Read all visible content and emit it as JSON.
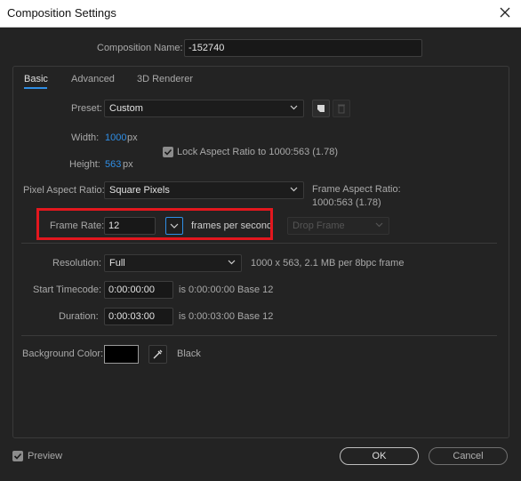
{
  "window": {
    "title": "Composition Settings"
  },
  "composition_name": {
    "label": "Composition Name:",
    "value": "-152740"
  },
  "tabs": [
    {
      "label": "Basic",
      "active": true
    },
    {
      "label": "Advanced",
      "active": false
    },
    {
      "label": "3D Renderer",
      "active": false
    }
  ],
  "preset": {
    "label": "Preset:",
    "value": "Custom"
  },
  "width": {
    "label": "Width:",
    "value": "1000",
    "unit": "px"
  },
  "height": {
    "label": "Height:",
    "value": "563",
    "unit": "px"
  },
  "lock_aspect": {
    "label": "Lock Aspect Ratio to 1000:563 (1.78)",
    "checked": true
  },
  "pixel_aspect": {
    "label": "Pixel Aspect Ratio:",
    "value": "Square Pixels"
  },
  "frame_aspect": {
    "label": "Frame Aspect Ratio:",
    "value": "1000:563 (1.78)"
  },
  "frame_rate": {
    "label": "Frame Rate:",
    "value": "12",
    "unit": "frames per second",
    "drop_frame": "Drop Frame"
  },
  "resolution": {
    "label": "Resolution:",
    "value": "Full",
    "info": "1000 x 563, 2.1 MB per 8bpc frame"
  },
  "start_timecode": {
    "label": "Start Timecode:",
    "value": "0:00:00:00",
    "info": "is 0:00:00:00  Base 12"
  },
  "duration": {
    "label": "Duration:",
    "value": "0:00:03:00",
    "info": "is 0:00:03:00  Base 12"
  },
  "background_color": {
    "label": "Background Color:",
    "swatch": "#000000",
    "name": "Black"
  },
  "preview": {
    "label": "Preview",
    "checked": true
  },
  "buttons": {
    "ok": "OK",
    "cancel": "Cancel"
  },
  "colors": {
    "accent": "#2f8ee5",
    "highlight": "#e3171e",
    "background": "#232323"
  }
}
